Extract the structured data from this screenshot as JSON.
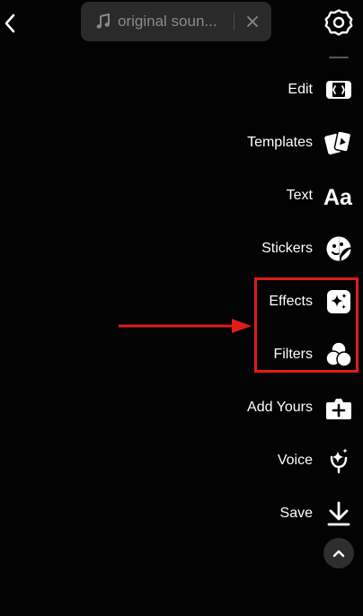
{
  "top_bar": {
    "sound_label": "original soun...",
    "back_icon": "chevron-left-icon",
    "settings_icon": "gear-icon"
  },
  "tools": [
    {
      "label": "Edit",
      "icon": "edit-clip-icon"
    },
    {
      "label": "Templates",
      "icon": "templates-cards-icon"
    },
    {
      "label": "Text",
      "icon": "text-aa-icon"
    },
    {
      "label": "Stickers",
      "icon": "sticker-icon"
    },
    {
      "label": "Effects",
      "icon": "sparkle-icon"
    },
    {
      "label": "Filters",
      "icon": "filters-circles-icon"
    },
    {
      "label": "Add Yours",
      "icon": "add-yours-icon"
    },
    {
      "label": "Voice",
      "icon": "voice-effect-icon"
    },
    {
      "label": "Save",
      "icon": "download-icon"
    }
  ],
  "collapse_icon": "chevron-up-icon",
  "annotation": {
    "color": "#e01b1b",
    "highlighted_tools": [
      "Effects",
      "Filters"
    ]
  }
}
